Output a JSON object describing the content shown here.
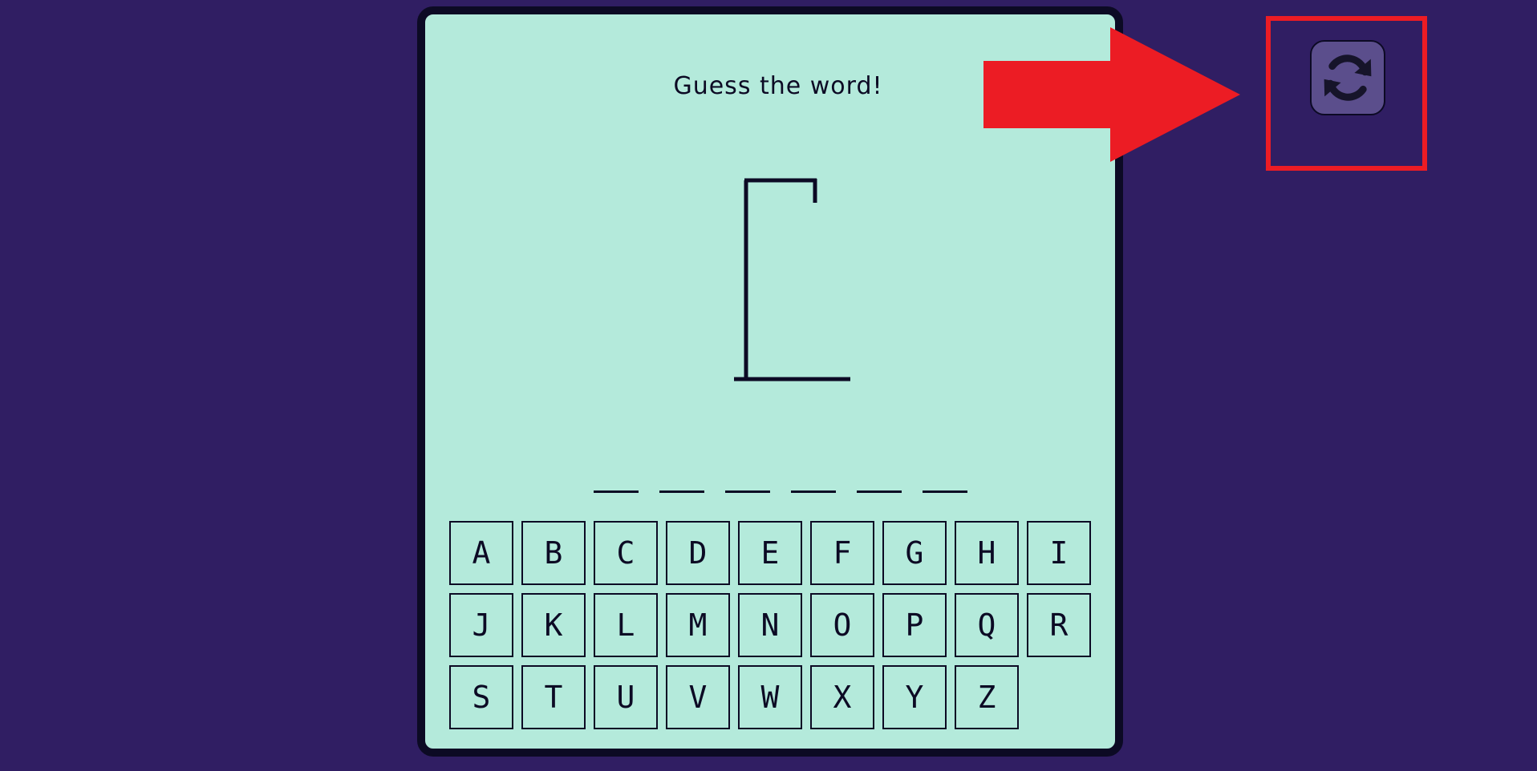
{
  "game": {
    "title": "Guess the word!",
    "word_blank_count": 6,
    "keyboard_letters": [
      "A",
      "B",
      "C",
      "D",
      "E",
      "F",
      "G",
      "H",
      "I",
      "J",
      "K",
      "L",
      "M",
      "N",
      "O",
      "P",
      "Q",
      "R",
      "S",
      "T",
      "U",
      "V",
      "W",
      "X",
      "Y",
      "Z"
    ]
  },
  "controls": {
    "reset_icon": "refresh-icon"
  },
  "annotation": {
    "arrow_color": "#ec1c24",
    "box_color": "#ec1c24"
  },
  "colors": {
    "background": "#301e63",
    "card": "#b4eadb",
    "ink": "#0c0a24",
    "button": "#5b4e8c"
  }
}
